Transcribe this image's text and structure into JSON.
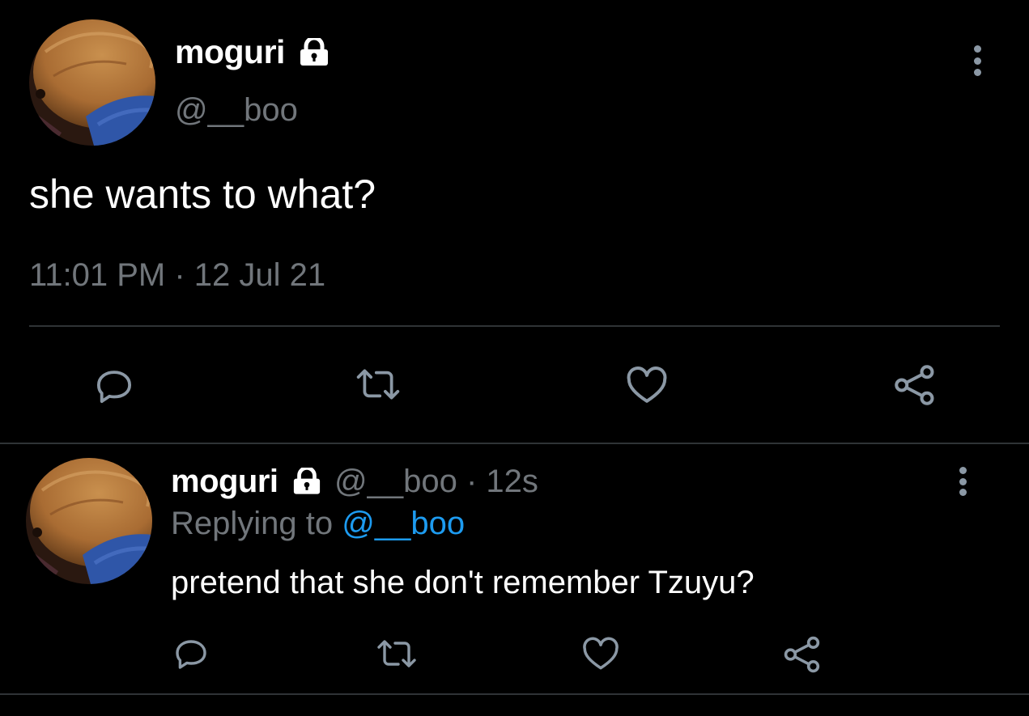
{
  "main_tweet": {
    "display_name": "moguri",
    "handle": "@__boo",
    "text": "she wants to what?",
    "timestamp": "11:01 PM · 12 Jul 21",
    "actions": [
      "reply-icon",
      "retweet-icon",
      "like-icon",
      "share-icon"
    ]
  },
  "reply_tweet": {
    "display_name": "moguri",
    "handle_time": "@__boo · 12s",
    "replying_prefix": "Replying to ",
    "replying_handle": "@__boo",
    "text": "pretend that she don't remember Tzuyu?",
    "actions": [
      "reply-icon",
      "retweet-icon",
      "like-icon",
      "share-icon"
    ]
  },
  "colors": {
    "background": "#000000",
    "text": "#e7e9ea",
    "muted": "#71767b",
    "link": "#1d9bf0",
    "divider": "#2f3336"
  }
}
